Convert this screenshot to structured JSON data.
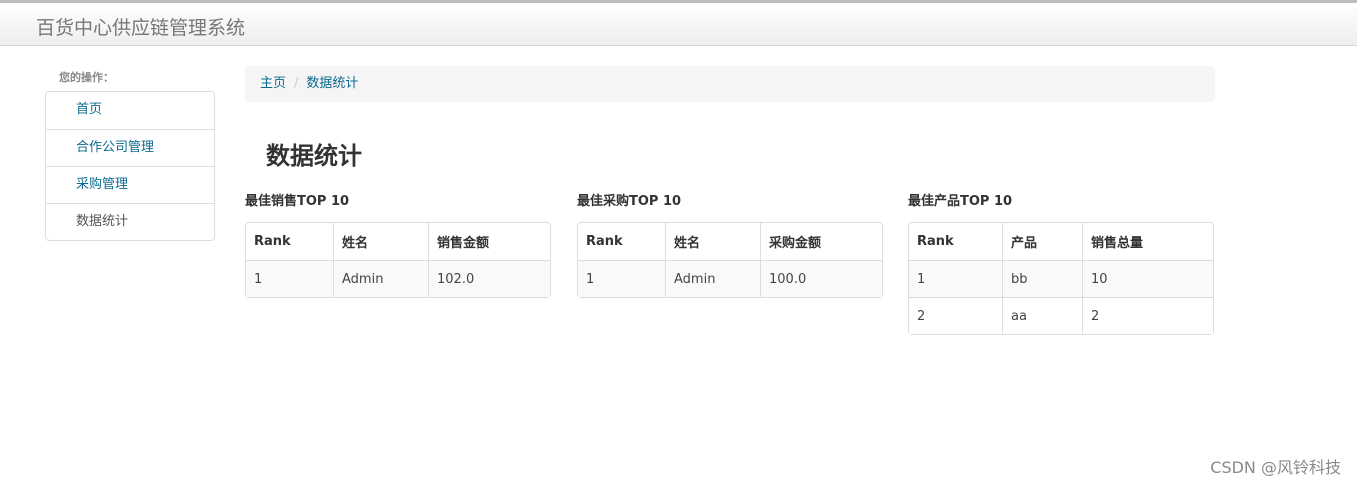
{
  "header": {
    "brand": "百货中心供应链管理系统"
  },
  "sidebar": {
    "caption": "您的操作：",
    "items": [
      {
        "label": "首页",
        "active": false
      },
      {
        "label": "合作公司管理",
        "active": false
      },
      {
        "label": "采购管理",
        "active": false
      },
      {
        "label": "数据统计",
        "active": true
      }
    ]
  },
  "breadcrumb": {
    "home": "主页",
    "separator": "/",
    "current": "数据统计"
  },
  "main": {
    "title": "数据统计",
    "panels": [
      {
        "title": "最佳销售TOP 10",
        "headers": [
          "Rank",
          "姓名",
          "销售金额"
        ],
        "rows": [
          [
            "1",
            "Admin",
            "102.0"
          ]
        ]
      },
      {
        "title": "最佳采购TOP 10",
        "headers": [
          "Rank",
          "姓名",
          "采购金额"
        ],
        "rows": [
          [
            "1",
            "Admin",
            "100.0"
          ]
        ]
      },
      {
        "title": "最佳产品TOP 10",
        "headers": [
          "Rank",
          "产品",
          "销售总量"
        ],
        "rows": [
          [
            "1",
            "bb",
            "10"
          ],
          [
            "2",
            "aa",
            "2"
          ]
        ]
      }
    ]
  },
  "watermark": "CSDN @风铃科技"
}
